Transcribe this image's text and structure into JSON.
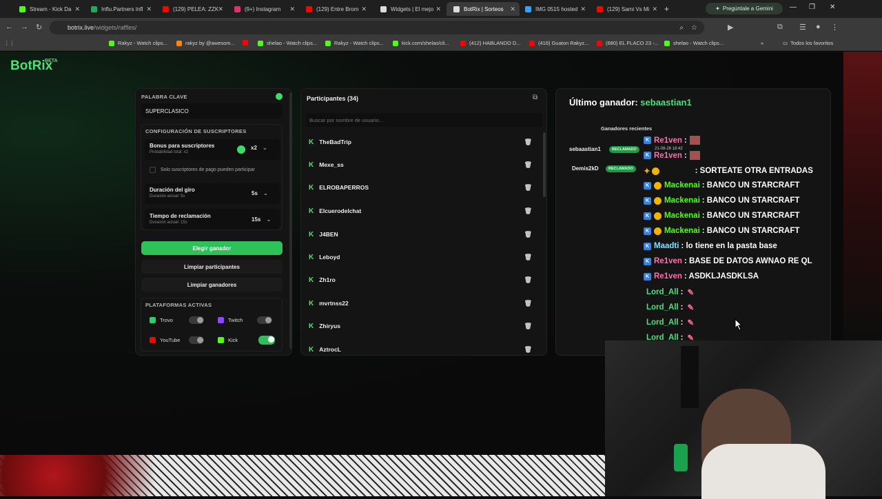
{
  "browser": {
    "tabs": [
      {
        "label": "Stream - Kick Da",
        "color": "#53fc18"
      },
      {
        "label": "Influ.Partners Infl",
        "color": "#22aa55"
      },
      {
        "label": "(129) PELEA: ZZK",
        "color": "#ff0000"
      },
      {
        "label": "(9+) Instagram",
        "color": "#e1306c"
      },
      {
        "label": "(129) Entre Brom",
        "color": "#ff0000"
      },
      {
        "label": "Widgets | El mejo",
        "color": "#ffffff"
      },
      {
        "label": "BotRix | Sorteos",
        "color": "#ffffff"
      },
      {
        "label": "IMG 0515 hosted",
        "color": "#3aa0ff"
      },
      {
        "label": "(129) Sami Vs Mi",
        "color": "#ff0000"
      }
    ],
    "new_tab": "+",
    "gemini_label": "Pregúntale a Gemini",
    "url_host": "botrix.live",
    "url_path": "/widgets/raffles/",
    "bookmarks": [
      {
        "label": "Rakyz - Watch clips...",
        "color": "#53fc18"
      },
      {
        "label": "rakyz by @awesom...",
        "color": "#ff8a00"
      },
      {
        "label": "",
        "color": "#ff0000"
      },
      {
        "label": "shelao - Watch clips...",
        "color": "#53fc18"
      },
      {
        "label": "Rakyz - Watch clips...",
        "color": "#53fc18"
      },
      {
        "label": "kick.com/shelao/cli...",
        "color": "#53fc18"
      },
      {
        "label": "(412) HABLANDO D...",
        "color": "#ff0000"
      },
      {
        "label": "(416) Guaton Rakyz...",
        "color": "#ff0000"
      },
      {
        "label": "(680) EL FLACO 23 -...",
        "color": "#ff0000"
      },
      {
        "label": "shelao - Watch clips...",
        "color": "#53fc18"
      }
    ],
    "all_favorites": "Todos los favoritos"
  },
  "app": {
    "logo": "BotRix",
    "logo_tag": "BETA"
  },
  "settings": {
    "keyword_label": "PALABRA CLAVE",
    "keyword_value": "SUPERCLASICO",
    "subs_section": "CONFIGURACIÓN DE SUSCRIPTORES",
    "bonus_label": "Bonus para suscriptores",
    "bonus_sub": "Probabilidad total: x2",
    "bonus_value": "x2",
    "paid_only_label": "Solo suscriptores de pago pueden participar",
    "spin_label": "Duración del giro",
    "spin_sub": "Duración actual: 5s",
    "spin_value": "5s",
    "claim_label": "Tiempo de reclamación",
    "claim_sub": "Duración actual: 15s",
    "claim_value": "15s",
    "choose_winner": "Elegir ganador",
    "clear_participants": "Limpiar participantes",
    "clear_winners": "Limpiar ganadores",
    "platforms_section": "PLATAFORMAS ACTIVAS",
    "platforms": [
      {
        "name": "Trovo",
        "enabled": false,
        "color": "#2bd06e"
      },
      {
        "name": "Twitch",
        "enabled": false,
        "color": "#9146ff"
      },
      {
        "name": "YouTube",
        "enabled": false,
        "color": "#ff0000"
      },
      {
        "name": "Kick",
        "enabled": true,
        "color": "#53fc18"
      }
    ]
  },
  "participants": {
    "title": "Participantes (34)",
    "search_placeholder": "Buscar por nombre de usuario...",
    "list": [
      "TheBadTrip",
      "Mexe_ss",
      "ELROBAPERROS",
      "Elcuerodelchat",
      "J4BEN",
      "Leboyd",
      "Zh1ro",
      "mvrtnss22",
      "Zhiryus",
      "AztrocL"
    ]
  },
  "winners": {
    "last_label": "Último ganador:",
    "last_name": "sebaastian1",
    "recent_label": "Ganadores recientes",
    "recent": [
      {
        "name": "sebaastian1",
        "status": "RECLAMADO"
      },
      {
        "name": "Demis2kD",
        "status": "RECLAMADO"
      }
    ]
  },
  "chat": {
    "timestamp": "21-08-26 18:42",
    "lines": [
      {
        "user": "Re1ven",
        "text": ":",
        "color": "#ff6fae"
      },
      {
        "user": "Re1ven",
        "text": ":",
        "color": "#ff6fae"
      },
      {
        "user": "",
        "text": ": SORTEATE OTRA ENTRADAS",
        "color": "#ff4d4d"
      },
      {
        "user": "Mackenai",
        "text": ": BANCO UN STARCRAFT",
        "color": "#53fc18"
      },
      {
        "user": "Mackenai",
        "text": ": BANCO UN STARCRAFT",
        "color": "#53fc18"
      },
      {
        "user": "Mackenai",
        "text": ": BANCO UN STARCRAFT",
        "color": "#53fc18"
      },
      {
        "user": "Mackenai",
        "text": ": BANCO UN STARCRAFT",
        "color": "#53fc18"
      },
      {
        "user": "Maadti",
        "text": ": lo tiene en la pasta base",
        "color": "#7fe3ff"
      },
      {
        "user": "Re1ven",
        "text": ": BASE DE DATOS AWNAO RE QL",
        "color": "#ff6fae"
      },
      {
        "user": "Re1ven",
        "text": ": ASDKLJASDKLSA",
        "color": "#ff6fae"
      },
      {
        "user": "Lord_All",
        "text": ":",
        "color": "#4be07a"
      },
      {
        "user": "Lord_All",
        "text": ":",
        "color": "#4be07a"
      },
      {
        "user": "Lord_All",
        "text": ":",
        "color": "#4be07a"
      },
      {
        "user": "Lord_All",
        "text": ":",
        "color": "#4be07a"
      }
    ]
  }
}
